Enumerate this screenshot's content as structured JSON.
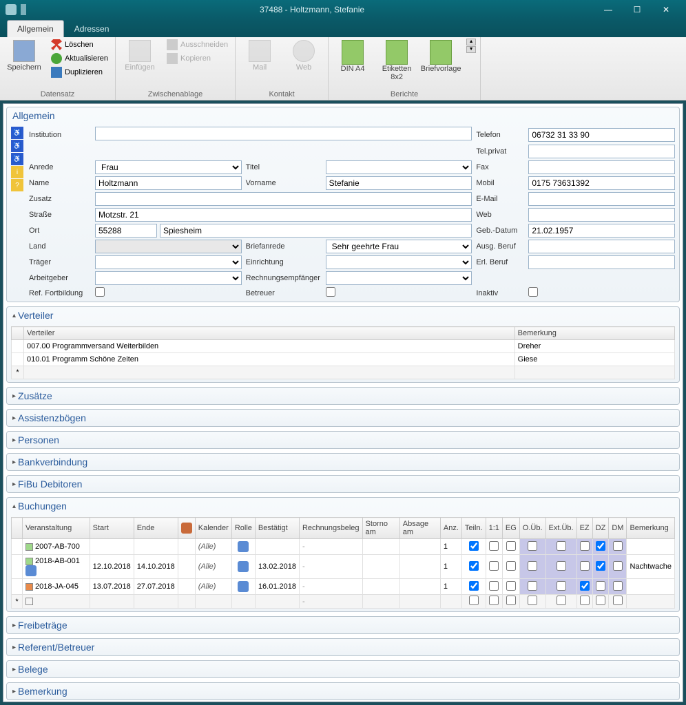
{
  "window": {
    "title": "37488 - Holtzmann, Stefanie"
  },
  "tabs": {
    "allgemein": "Allgemein",
    "adressen": "Adressen"
  },
  "ribbon": {
    "speichern": "Speichern",
    "loeschen": "Löschen",
    "aktualisieren": "Aktualisieren",
    "duplizieren": "Duplizieren",
    "datensatz": "Datensatz",
    "einfuegen": "Einfügen",
    "ausschneiden": "Ausschneiden",
    "kopieren": "Kopieren",
    "zwischenablage": "Zwischenablage",
    "mail": "Mail",
    "web": "Web",
    "kontakt": "Kontakt",
    "dina4": "DIN A4",
    "etiketten": "Etiketten 8x2",
    "briefvorlage": "Briefvorlage",
    "berichte": "Berichte"
  },
  "panelAllgemein": {
    "title": "Allgemein",
    "labels": {
      "institution": "Institution",
      "telefon": "Telefon",
      "telprivat": "Tel.privat",
      "anrede": "Anrede",
      "titel": "Titel",
      "fax": "Fax",
      "name": "Name",
      "vorname": "Vorname",
      "mobil": "Mobil",
      "zusatz": "Zusatz",
      "email": "E-Mail",
      "strasse": "Straße",
      "web": "Web",
      "ort": "Ort",
      "gebdatum": "Geb.-Datum",
      "land": "Land",
      "briefanrede": "Briefanrede",
      "ausgberuf": "Ausg. Beruf",
      "traeger": "Träger",
      "einrichtung": "Einrichtung",
      "erlberuf": "Erl. Beruf",
      "arbeitgeber": "Arbeitgeber",
      "rechnungsempfaenger": "Rechnungsempfänger",
      "reffortbildung": "Ref. Fortbildung",
      "betreuer": "Betreuer",
      "inaktiv": "Inaktiv"
    },
    "values": {
      "institution": "",
      "telefon": "06732 31 33 90",
      "telprivat": "",
      "anrede": "Frau",
      "titel": "",
      "fax": "",
      "name": "Holtzmann",
      "vorname": "Stefanie",
      "mobil": "0175 73631392",
      "zusatz": "",
      "email": "",
      "strasse": "Motzstr. 21",
      "web": "",
      "ortplz": "55288",
      "ortname": "Spiesheim",
      "gebdatum": "21.02.1957",
      "land": "",
      "briefanrede": "Sehr geehrte Frau",
      "ausgberuf": "",
      "traeger": "",
      "einrichtung": "",
      "erlberuf": "",
      "arbeitgeber": "",
      "rechnungsempfaenger": ""
    }
  },
  "verteiler": {
    "title": "Verteiler",
    "cols": {
      "verteiler": "Verteiler",
      "bemerkung": "Bemerkung"
    },
    "rows": [
      {
        "verteiler": "007.00 Programmversand Weiterbilden",
        "bemerkung": "Dreher"
      },
      {
        "verteiler": "010.01 Programm Schöne Zeiten",
        "bemerkung": "Giese"
      }
    ]
  },
  "sections": {
    "zusaetze": "Zusätze",
    "assistenzboegen": "Assistenzbögen",
    "personen": "Personen",
    "bankverbindung": "Bankverbindung",
    "fibu": "FiBu Debitoren",
    "freibetraege": "Freibeträge",
    "referent": "Referent/Betreuer",
    "belege": "Belege",
    "bemerkung": "Bemerkung"
  },
  "buchungen": {
    "title": "Buchungen",
    "cols": {
      "veranstaltung": "Veranstaltung",
      "start": "Start",
      "ende": "Ende",
      "kalender": "Kalender",
      "rolle": "Rolle",
      "bestaetigt": "Bestätigt",
      "rechnungsbeleg": "Rechnungsbeleg",
      "stornoam": "Storno am",
      "absageam": "Absage am",
      "anz": "Anz.",
      "teiln": "Teiln.",
      "11": "1:1",
      "eg": "EG",
      "oueb": "O.Üb.",
      "extueb": "Ext.Üb.",
      "ez": "EZ",
      "dz": "DZ",
      "dm": "DM",
      "bemerkung": "Bemerkung"
    },
    "rows": [
      {
        "sq": "g",
        "ver": "2007-AB-700",
        "start": "",
        "ende": "",
        "kal": "(Alle)",
        "best": "",
        "rb": "-",
        "anz": "1",
        "teiln": true,
        "11": false,
        "eg": false,
        "ou": false,
        "eu": false,
        "ez": false,
        "dz": true,
        "dm": false,
        "bem": ""
      },
      {
        "sq": "g",
        "ver": "2018-AB-001",
        "icon": true,
        "start": "12.10.2018",
        "ende": "14.10.2018",
        "kal": "(Alle)",
        "best": "13.02.2018",
        "rb": "-",
        "anz": "1",
        "teiln": true,
        "11": false,
        "eg": false,
        "ou": false,
        "eu": false,
        "ez": false,
        "dz": true,
        "dm": false,
        "bem": "Nachtwache"
      },
      {
        "sq": "o",
        "ver": "2018-JA-045",
        "start": "13.07.2018",
        "ende": "27.07.2018",
        "kal": "(Alle)",
        "best": "16.01.2018",
        "rb": "-",
        "anz": "1",
        "teiln": true,
        "11": false,
        "eg": false,
        "ou": false,
        "eu": false,
        "ez": true,
        "dz": false,
        "dm": false,
        "bem": ""
      }
    ]
  }
}
